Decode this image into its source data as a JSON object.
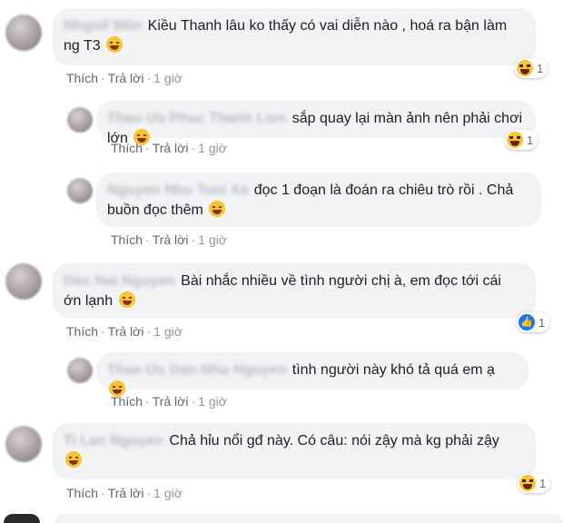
{
  "comments": [
    {
      "author": "Nhgoll Mlin",
      "text": "Kiều Thanh lâu ko thấy có vai diễn nào , hoá ra bận làm ng T3",
      "line1": "Kiều Thanh lâu ko thấy có vai diễn nào , hoá ra bận làm",
      "line2": "ng T3",
      "emoji": "grinning-sweat-emoji",
      "actions": {
        "like": "Thích",
        "reply": "Trả lời",
        "time": "1 giờ"
      },
      "reaction": {
        "type": "haha",
        "count": "1"
      }
    },
    {
      "author": "Thao Uu Phuc Thanh Lien",
      "text": "sắp quay lại màn ảnh nên phải chơi lớn",
      "emoji": "grinning-sweat-emoji",
      "actions": {
        "like": "Thích",
        "reply": "Trả lời",
        "time": "1 giờ"
      },
      "reaction": {
        "type": "haha",
        "count": "1"
      }
    },
    {
      "author": "Nguyen Nhu Tuoi Xa",
      "line1": "đọc 1 đoạn là đoán ra chiêu trò rồi . Chả",
      "line2": "buồn đọc thêm",
      "emoji": "slightly-smiling-emoji",
      "actions": {
        "like": "Thích",
        "reply": "Trả lời",
        "time": "1 giờ"
      }
    },
    {
      "author": "Doc Nai Nguyen",
      "line1": "Bài nhắc nhiều về tình người chị à, em đọc tới cái",
      "line2": "ớn lạnh",
      "emoji": "tongue-emoji",
      "actions": {
        "like": "Thích",
        "reply": "Trả lời",
        "time": "1 giờ"
      },
      "reaction": {
        "type": "like",
        "count": "1"
      }
    },
    {
      "author": "Thao Uu Dan Nhu Nguyen",
      "text": "tình người này khó tả quá em ạ",
      "emoji": "smiling-emoji",
      "actions": {
        "like": "Thích",
        "reply": "Trả lời",
        "time": "1 giờ"
      }
    },
    {
      "author": "Ti Lan Nguyen",
      "line1": "Chả hỉu nổi gđ này. Có câu: nói zậy mà kg phải zậy",
      "line2": "",
      "emoji": "tongue-emoji",
      "actions": {
        "like": "Thích",
        "reply": "Trả lời",
        "time": "1 giờ"
      },
      "reaction": {
        "type": "haha",
        "count": "1"
      }
    }
  ]
}
